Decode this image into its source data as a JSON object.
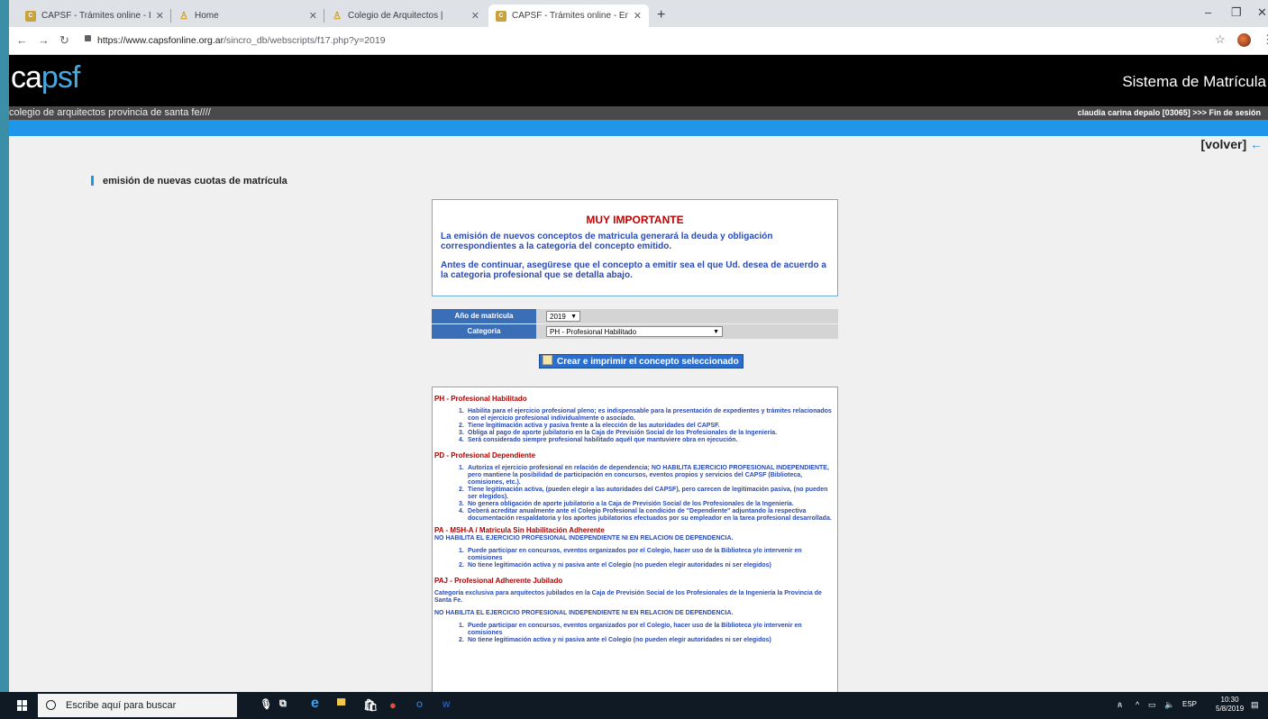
{
  "browser": {
    "tabs": [
      {
        "title": "CAPSF - Trámites online - Inicio d",
        "fav": "capsf"
      },
      {
        "title": "Home",
        "fav": "home"
      },
      {
        "title": "Colegio de Arquitectos |",
        "fav": "home"
      },
      {
        "title": "CAPSF - Trámites online - Emisió",
        "fav": "capsf"
      }
    ],
    "url_host": "https://www.capsfonline.org.ar",
    "url_path": "/sincro_db/webscripts/f17.php?y=2019"
  },
  "site": {
    "logo_a": "ca",
    "logo_b": "psf",
    "system_title": "Sistema de Matrícula",
    "subtitle": "colegio de arquitectos provincia de santa fe////",
    "user_info": "claudia carina depalo [03065] >>> Fin de sesión",
    "volver": "[volver]",
    "volver_arrow": "←"
  },
  "section_title": "emisión de nuevas cuotas de matrícula",
  "important": {
    "title": "MUY IMPORTANTE",
    "p1": "La emisión de nuevos conceptos de matricula generará la deuda y obligación correspondientes a la categoria del concepto emitido.",
    "p2": "Antes de continuar, asegürese que el concepto a emitir sea el que Ud. desea de acuerdo a la categoria profesional que se detalla abajo."
  },
  "form": {
    "year_label": "Año de matricula",
    "year_value": "2019",
    "category_label": "Categoria",
    "category_value": "PH - Profesional Habilitado",
    "create_button": "Crear e imprimir el concepto seleccionado"
  },
  "categories": {
    "ph": {
      "title": "PH - Profesional Habilitado",
      "items": [
        "Habilita para el ejercicio profesional pleno; es indispensable para la presentación de expedientes y trámites relacionados con el ejercicio profesional individualmente o asociado.",
        "Tiene legitimación activa y pasiva frente a la elección de las autoridades del CAPSF.",
        "Obliga al pago de aporte jubilatorio en la Caja de Previsión Social de los Profesionales de la Ingeniería.",
        "Será considerado siempre profesional habilitado aquél que mantuviere obra en ejecución."
      ]
    },
    "pd": {
      "title": "PD - Profesional Dependiente",
      "items": [
        "Autoriza el ejercicio profesional en relación de dependencia; NO HABILITA EJERCICIO PROFESIONAL INDEPENDIENTE, pero mantiene la posibilidad de participación en concursos, eventos propios y servicios del CAPSF (Biblioteca, comisiones, etc.).",
        "Tiene legitimación activa, (pueden elegir a las autoridades del CAPSF), pero carecen de legitimación pasiva, (no pueden ser elegidos).",
        "No genera obligación de aporte jubilatorio a la Caja de Previsión Social de los Profesionales de la Ingeniería.",
        "Deberá acreditar anualmente ante el Colegio Profesional la condición de \"Dependiente\" adjuntando la respectiva documentación respaldatoria y los aportes jubilatorios efectuados por su empleador en la tarea profesional desarrollada."
      ]
    },
    "pa": {
      "title": "PA - MSH-A / Matricula Sin Habilitación Adherente",
      "note": "NO HABILITA EL EJERCICIO PROFESIONAL INDEPENDIENTE NI EN RELACION DE DEPENDENCIA.",
      "items": [
        "Puede participar en concursos, eventos organizados por el Colegio, hacer uso de la Biblioteca y/o intervenir en comisiones",
        "No tiene legitimación activa y ni pasiva ante el Colegio (no pueden elegir autoridades ni ser elegidos)"
      ]
    },
    "paj": {
      "title": "PAJ - Profesional Adherente Jubilado",
      "desc": "Categoría exclusiva para arquitectos jubilados en la Caja de Previsión Social de los Profesionales de la Ingeniería la Provincia de Santa Fe.",
      "note": "NO HABILITA EL EJERCICIO PROFESIONAL INDEPENDIENTE NI EN RELACION DE DEPENDENCIA.",
      "items": [
        "Puede participar en concursos, eventos organizados por el Colegio, hacer uso de la Biblioteca y/o intervenir en comisiones",
        "No tiene legitimación activa y ni pasiva ante el Colegio (no pueden elegir autoridades ni ser elegidos)"
      ]
    }
  },
  "taskbar": {
    "search_placeholder": "Escribe aquí para buscar",
    "lang": "ESP",
    "time": "10:30",
    "date": "5/8/2019"
  }
}
